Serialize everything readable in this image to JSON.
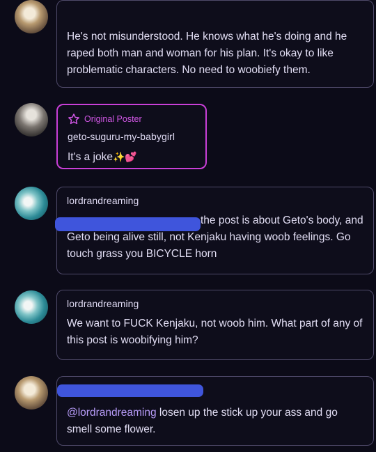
{
  "comments": [
    {
      "username": "",
      "text": "He's not misunderstood. He knows what he's doing and he raped both man and woman for his plan. It's okay to like problematic characters. No need to woobiefy them."
    },
    {
      "badge": "Original Poster",
      "username": "geto-suguru-my-babygirl",
      "text": "It's a joke",
      "emojis": "✨💕"
    },
    {
      "username": "lordrandreaming",
      "text": "the post is about Geto's body, and Geto being alive still, not Kenjaku having woob feelings. Go touch grass you BICYCLE horn"
    },
    {
      "username": "lordrandreaming",
      "text": "We want to FUCK Kenjaku, not woob him. What part of any of this post is woobifying him?"
    },
    {
      "username": "",
      "mention": "@lordrandreaming",
      "text": " losen up the stick up your ass and go smell some flower."
    }
  ],
  "colors": {
    "accent_op": "#c93fd7",
    "redaction": "#3f55dc",
    "mention": "#b79cf8"
  },
  "icons": {
    "op_badge": "star-outline-icon"
  }
}
